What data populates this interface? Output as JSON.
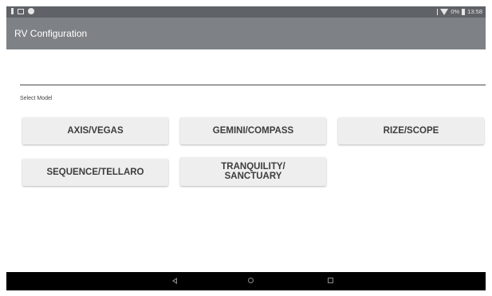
{
  "status_bar": {
    "left_icons": [
      "usb-icon",
      "image-notification-icon",
      "circle-notification-icon"
    ],
    "right_icons": [
      "bluetooth-icon",
      "wifi-icon",
      "battery-icon"
    ],
    "battery_text": "0%",
    "time": "13:58"
  },
  "app_bar": {
    "title": "RV Configuration"
  },
  "main": {
    "select_label": "Select Model",
    "models": [
      {
        "label": "AXIS/VEGAS"
      },
      {
        "label": "GEMINI/COMPASS"
      },
      {
        "label": "RIZE/SCOPE"
      },
      {
        "label": "SEQUENCE/TELLARO"
      },
      {
        "label": "TRANQUILITY/\nSANCTUARY"
      }
    ]
  },
  "nav_bar": {
    "icons": [
      "back-icon",
      "home-icon",
      "recents-icon"
    ]
  },
  "colors": {
    "status_bar": "#5f6368",
    "app_bar": "#7e8287",
    "button_bg": "#eeeeee",
    "button_text": "#3d3d3d",
    "nav_bar": "#000000"
  }
}
